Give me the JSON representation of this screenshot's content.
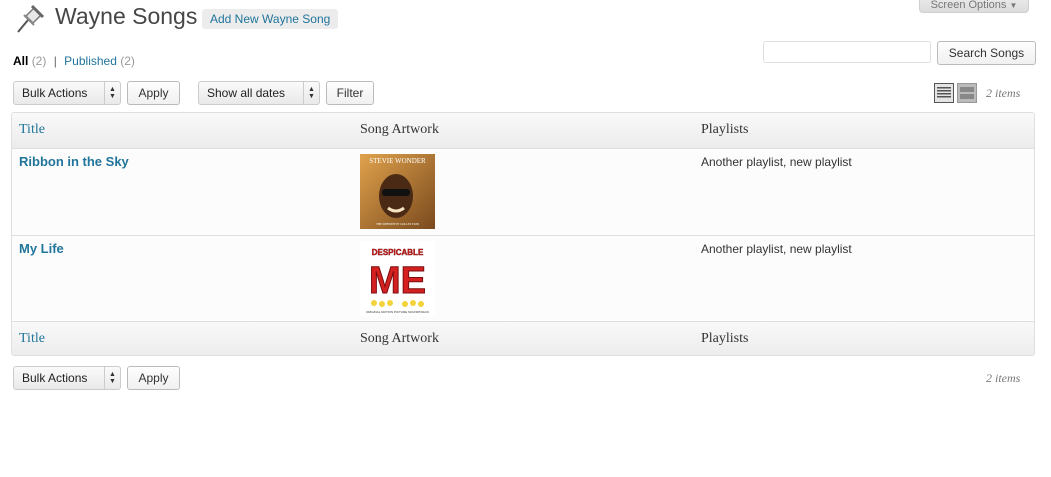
{
  "header": {
    "title": "Wayne Songs",
    "add_new_label": "Add New Wayne Song",
    "screen_options_label": "Screen Options"
  },
  "views": {
    "all_label": "All",
    "all_count": "(2)",
    "separator": "|",
    "published_label": "Published",
    "published_count": "(2)"
  },
  "search": {
    "value": "",
    "button_label": "Search Songs"
  },
  "tablenav_top": {
    "bulk_actions": "Bulk Actions",
    "apply_label": "Apply",
    "dates_select": "Show all dates",
    "filter_label": "Filter",
    "items_count": "2 items"
  },
  "table": {
    "columns": [
      "Title",
      "Song Artwork",
      "Playlists"
    ],
    "rows": [
      {
        "title": "Ribbon in the Sky",
        "artwork": {
          "top_text": "STEVIE WONDER",
          "bottom_text": "THE DEFINITIVE COLLECTION",
          "bg_color": "#c9873a"
        },
        "playlists": "Another playlist, new playlist"
      },
      {
        "title": "My Life",
        "artwork": {
          "top_text": "DESPICABLE",
          "big_text": "ME",
          "bottom_text": "ORIGINAL MOTION PICTURE SOUNDTRACK",
          "bg_color": "#ffffff"
        },
        "playlists": "Another playlist, new playlist"
      }
    ]
  },
  "tablenav_bottom": {
    "bulk_actions": "Bulk Actions",
    "apply_label": "Apply",
    "items_count": "2 items"
  },
  "colors": {
    "link": "#21759b",
    "header_bg": "#f9f9f9",
    "border": "#dfdfdf"
  }
}
